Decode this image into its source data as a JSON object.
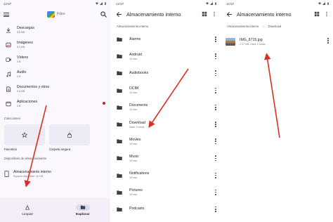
{
  "colors": {
    "accent": "#d93025",
    "nav_active": "#d9dbf5",
    "folder": "#3c4043"
  },
  "screen1": {
    "status": {
      "time": "12:57"
    },
    "topbar": {
      "title": "Files",
      "menu_icon": "menu-icon",
      "search_icon": "search-icon"
    },
    "categories": [
      {
        "label": "Descargas",
        "size": "5,8 MB",
        "icon": "download-icon"
      },
      {
        "label": "Imágenes",
        "size": "5,4 MB",
        "icon": "image-icon"
      },
      {
        "label": "Vídeos",
        "size": "0 B",
        "icon": "video-icon"
      },
      {
        "label": "Audio",
        "size": "0 B",
        "icon": "audio-icon"
      },
      {
        "label": "Documentos y otros",
        "size": "5,8 MB",
        "icon": "document-icon"
      },
      {
        "label": "Aplicaciones",
        "size": "0 B",
        "icon": "apps-icon"
      }
    ],
    "collections_label": "Colecciones",
    "collections": [
      {
        "label": "Favoritos",
        "icon": "star-icon"
      },
      {
        "label": "Carpeta segura",
        "icon": "lock-icon"
      }
    ],
    "storage_label": "Dispositivos de almacenamiento",
    "storage": {
      "label": "Almacenamiento interno",
      "sub": "Espacio disponible: 16 GB"
    },
    "bottom_nav": [
      {
        "label": "Limpiar",
        "active": false
      },
      {
        "label": "Explorar",
        "active": true
      }
    ]
  },
  "screen2": {
    "status": {
      "time": "12:57"
    },
    "title": "Almacenamiento interno",
    "breadcrumb": [
      "Almacenamiento interno"
    ],
    "folders": [
      {
        "name": "Alarms",
        "date": ""
      },
      {
        "name": "Android",
        "date": "15 mar"
      },
      {
        "name": "Audiobooks",
        "date": ""
      },
      {
        "name": "DCIM",
        "date": "15 mar"
      },
      {
        "name": "Documents",
        "date": "15 mar"
      },
      {
        "name": "Download",
        "date": "Hace 2 horas"
      },
      {
        "name": "Movies",
        "date": "15 mar"
      },
      {
        "name": "Music",
        "date": "15 mar"
      },
      {
        "name": "Notifications",
        "date": "15 mar"
      },
      {
        "name": "Pictures",
        "date": "15 mar"
      },
      {
        "name": "Podcasts",
        "date": ""
      }
    ]
  },
  "screen3": {
    "status": {
      "time": "12:57"
    },
    "title": "Almacenamiento interno",
    "breadcrumb": [
      "Almacenamiento interno",
      "Download"
    ],
    "files": [
      {
        "name": "IMG_8715.jpg",
        "meta": "2,37 MB, Hace 2 horas"
      }
    ]
  }
}
